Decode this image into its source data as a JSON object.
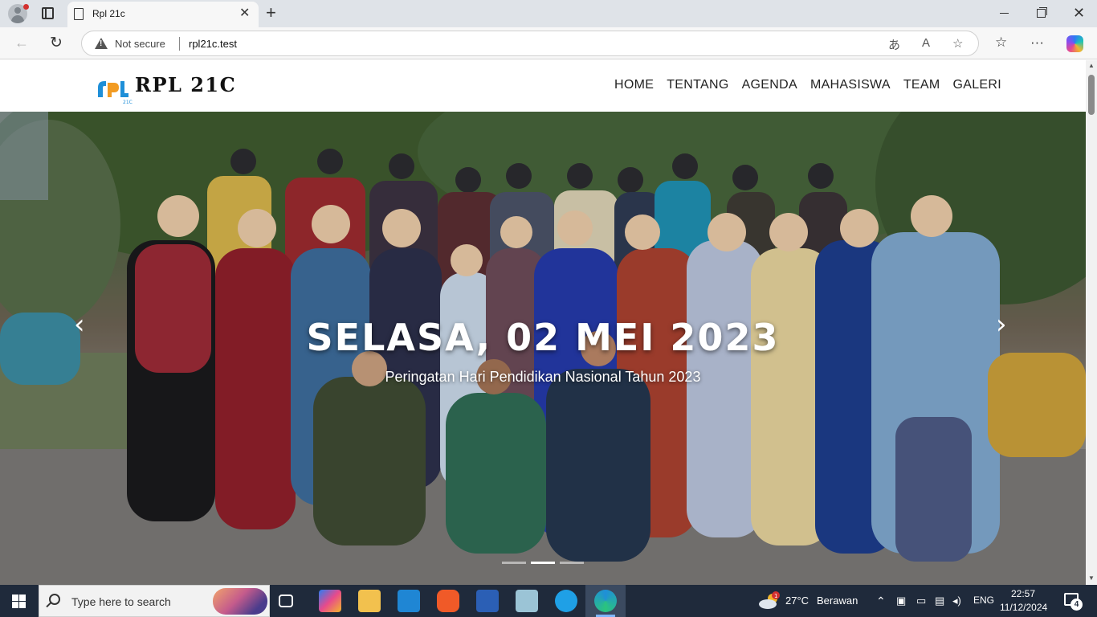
{
  "browser": {
    "tab_title": "Rpl 21c",
    "security_label": "Not secure",
    "url": "rpl21c.test"
  },
  "site": {
    "brand": "RPL 21C",
    "logo_text": "21C",
    "nav": [
      "HOME",
      "TENTANG",
      "AGENDA",
      "MAHASISWA",
      "TEAM",
      "GALERI"
    ]
  },
  "carousel": {
    "title": "SELASA, 02 MEI 2023",
    "subtitle": "Peringatan Hari Pendidikan Nasional Tahun 2023",
    "slide_count": 3,
    "active_slide": 2
  },
  "taskbar": {
    "search_placeholder": "Type here to search",
    "temperature": "27°C",
    "weather": "Berawan",
    "language": "ENG",
    "time": "22:57",
    "date": "11/12/2024",
    "notification_count": "4",
    "weather_badge": "1"
  }
}
